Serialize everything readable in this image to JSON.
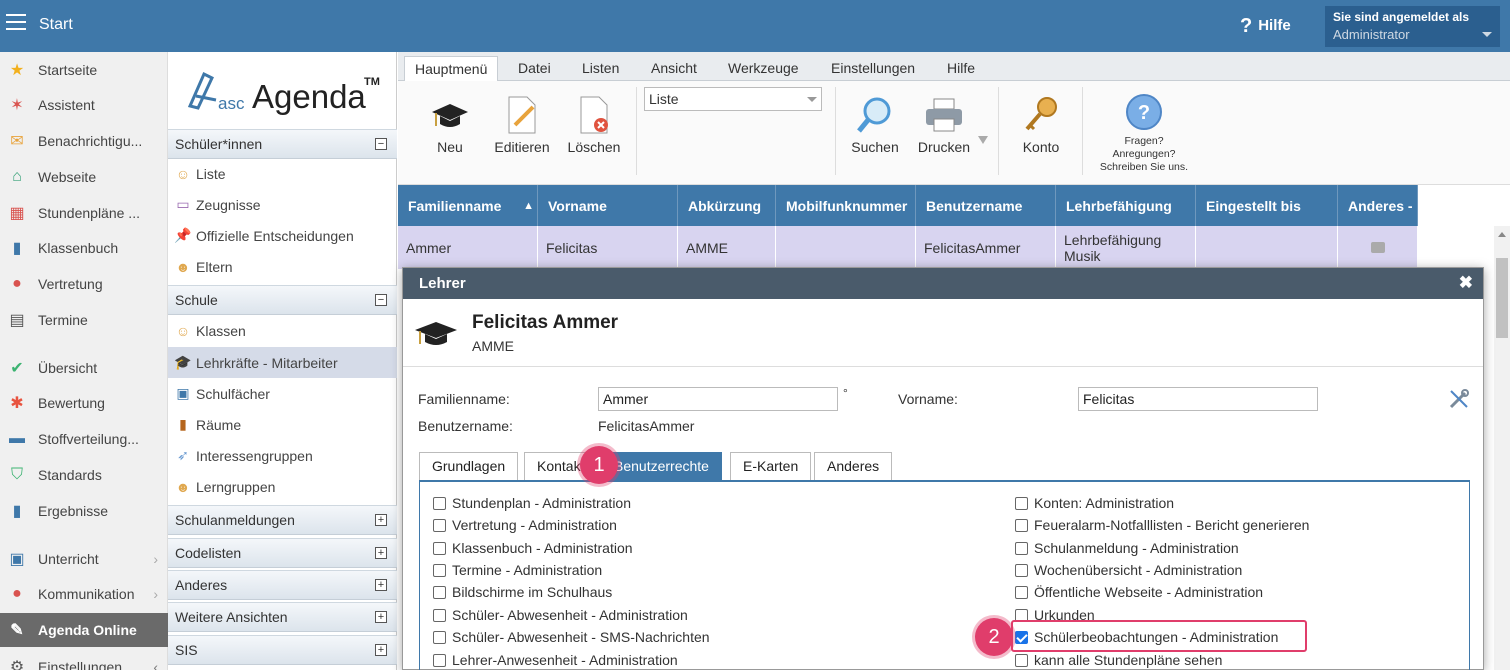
{
  "topbar": {
    "title": "Start",
    "help_label": "Hilfe",
    "login_line1": "Sie sind angemeldet als",
    "login_line2": "Administrator"
  },
  "leftnav": {
    "items": [
      {
        "label": "Startseite",
        "icon": "star-icon"
      },
      {
        "label": "Assistent",
        "icon": "wand-icon"
      },
      {
        "label": "Benachrichtigu...",
        "icon": "envelope-icon"
      },
      {
        "label": "Webseite",
        "icon": "home-icon"
      },
      {
        "label": "Stundenpläne ...",
        "icon": "timetable-icon"
      },
      {
        "label": "Klassenbuch",
        "icon": "book-icon"
      },
      {
        "label": "Vertretung",
        "icon": "person-icon"
      },
      {
        "label": "Termine",
        "icon": "calendar-icon"
      },
      {
        "label": "Übersicht",
        "icon": "check-circle-icon"
      },
      {
        "label": "Bewertung",
        "icon": "rating-icon"
      },
      {
        "label": "Stoffverteilung...",
        "icon": "briefcase-icon"
      },
      {
        "label": "Standards",
        "icon": "shield-icon"
      },
      {
        "label": "Ergebnisse",
        "icon": "bar-chart-icon"
      },
      {
        "label": "Unterricht",
        "icon": "teaching-icon"
      },
      {
        "label": "Kommunikation",
        "icon": "chat-icon"
      },
      {
        "label": "Agenda Online",
        "icon": "agenda-icon"
      },
      {
        "label": "Einstellungen",
        "icon": "gear-icon"
      }
    ]
  },
  "sidebar": {
    "logo_asc": "asc",
    "logo_agenda": "Agenda",
    "logo_tm": "TM",
    "sections": [
      {
        "label": "Schüler*innen",
        "toggle": "−"
      },
      {
        "label": "Schule",
        "toggle": "−"
      },
      {
        "label": "Schulanmeldungen",
        "toggle": "+"
      },
      {
        "label": "Codelisten",
        "toggle": "+"
      },
      {
        "label": "Anderes",
        "toggle": "+"
      },
      {
        "label": "Weitere Ansichten",
        "toggle": "+"
      },
      {
        "label": "SIS",
        "toggle": "+"
      }
    ],
    "subitems": [
      {
        "label": "Liste"
      },
      {
        "label": "Zeugnisse"
      },
      {
        "label": "Offizielle Entscheidungen"
      },
      {
        "label": "Eltern"
      },
      {
        "label": "Klassen"
      },
      {
        "label": "Lehrkräfte - Mitarbeiter"
      },
      {
        "label": "Schulfächer"
      },
      {
        "label": "Räume"
      },
      {
        "label": "Interessengruppen"
      },
      {
        "label": "Lerngruppen"
      }
    ]
  },
  "menutabs": [
    "Hauptmenü",
    "Datei",
    "Listen",
    "Ansicht",
    "Werkzeuge",
    "Einstellungen",
    "Hilfe"
  ],
  "toolbar": {
    "new_label": "Neu",
    "edit_label": "Editieren",
    "delete_label": "Löschen",
    "list_select": "Liste",
    "search_label": "Suchen",
    "print_label": "Drucken",
    "account_label": "Konto",
    "feedback_line1": "Fragen?",
    "feedback_line2": "Anregungen?",
    "feedback_line3": "Schreiben Sie uns."
  },
  "table": {
    "columns": [
      "Familienname",
      "Vorname",
      "Abkürzung",
      "Mobilfunknummer",
      "Benutzername",
      "Lehrbefähigung",
      "Eingestellt bis",
      "Anderes -"
    ],
    "sort_indicator": "▲",
    "row": {
      "familienname": "Ammer",
      "vorname": "Felicitas",
      "abkuerzung": "AMME",
      "mobil": "",
      "benutzername": "FelicitasAmmer",
      "lehrbefaehigung_l1": "Lehrbefähigung",
      "lehrbefaehigung_l2": "Musik",
      "eingestellt": ""
    }
  },
  "dialog": {
    "title": "Lehrer",
    "close": "✖",
    "name": "Felicitas Ammer",
    "abbr": "AMME",
    "familienname_label": "Familienname:",
    "familienname_value": "Ammer",
    "degree_mark": "°",
    "vorname_label": "Vorname:",
    "vorname_value": "Felicitas",
    "benutzername_label": "Benutzername:",
    "benutzername_value": "FelicitasAmmer",
    "tabs": [
      "Grundlagen",
      "Kontakt",
      "Benutzerrechte",
      "E-Karten",
      "Anderes"
    ],
    "active_tab": "Benutzerrechte",
    "permissions_left": [
      {
        "label": "Stundenplan - Administration",
        "checked": false
      },
      {
        "label": "Vertretung - Administration",
        "checked": false
      },
      {
        "label": "Klassenbuch - Administration",
        "checked": false
      },
      {
        "label": "Termine - Administration",
        "checked": false
      },
      {
        "label": "Bildschirme im Schulhaus",
        "checked": false
      },
      {
        "label": "Schüler- Abwesenheit - Administration",
        "checked": false
      },
      {
        "label": "Schüler- Abwesenheit - SMS-Nachrichten",
        "checked": false
      },
      {
        "label": "Lehrer-Anwesenheit - Administration",
        "checked": false
      }
    ],
    "permissions_right": [
      {
        "label": "Konten: Administration",
        "checked": false
      },
      {
        "label": "Feueralarm-Notfalllisten - Bericht generieren",
        "checked": false
      },
      {
        "label": "Schulanmeldung - Administration",
        "checked": false
      },
      {
        "label": "Wochenübersicht - Administration",
        "checked": false
      },
      {
        "label": "Öffentliche Webseite - Administration",
        "checked": false
      },
      {
        "label": "Urkunden",
        "checked": false
      },
      {
        "label": "Schülerbeobachtungen - Administration",
        "checked": true
      },
      {
        "label": "kann alle Stundenpläne sehen",
        "checked": false
      }
    ]
  },
  "callouts": [
    "1",
    "2"
  ],
  "colors": {
    "accent": "#3f78a9",
    "callout": "#e03d6b",
    "header_dark": "#4a5b6b"
  }
}
